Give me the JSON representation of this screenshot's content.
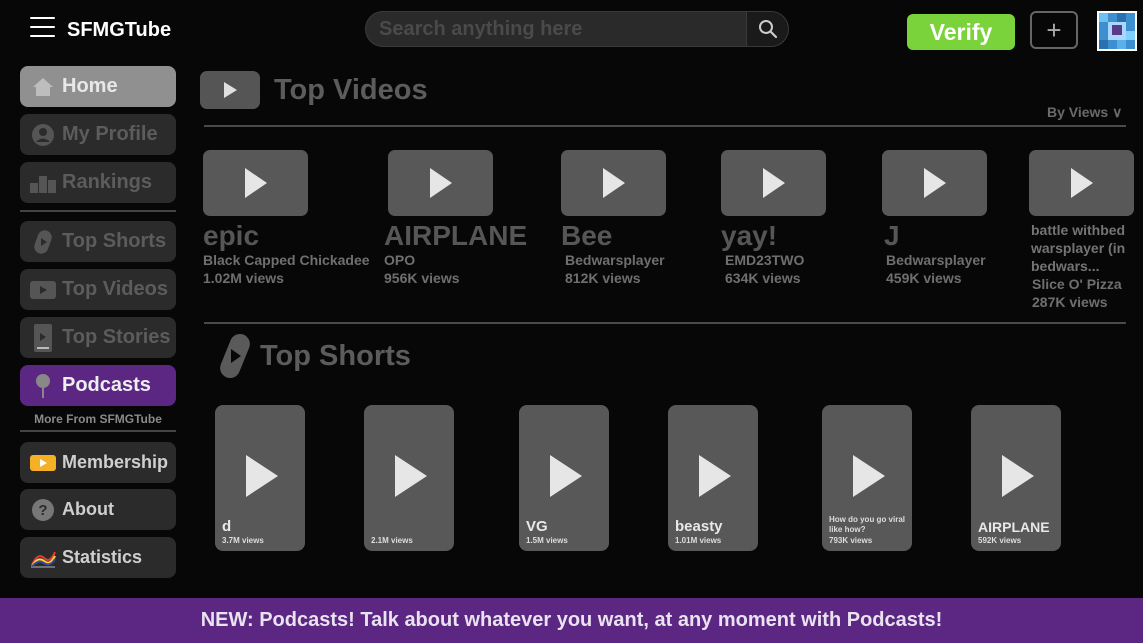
{
  "header": {
    "brand": "SFMGTube",
    "search_placeholder": "Search anything here",
    "verify_label": "Verify",
    "plus_label": "+"
  },
  "sidebar": {
    "items": [
      {
        "label": "Home",
        "icon": "home-icon"
      },
      {
        "label": "My Profile",
        "icon": "profile-icon"
      },
      {
        "label": "Rankings",
        "icon": "podium-icon"
      },
      {
        "label": "Top Shorts",
        "icon": "shorts-icon"
      },
      {
        "label": "Top Videos",
        "icon": "video-icon"
      },
      {
        "label": "Top Stories",
        "icon": "story-icon"
      },
      {
        "label": "Podcasts",
        "icon": "microphone-icon"
      }
    ],
    "more_from": "More From SFMGTube",
    "lower_items": [
      {
        "label": "Membership",
        "icon": "membership-icon"
      },
      {
        "label": "About",
        "icon": "question-icon"
      },
      {
        "label": "Statistics",
        "icon": "chart-icon"
      }
    ]
  },
  "top_videos": {
    "title": "Top Videos",
    "sort_label": "By Views ∨",
    "items": [
      {
        "title": "epic",
        "author": "Black Capped Chickadee",
        "views": "1.02M views"
      },
      {
        "title": "AIRPLANE",
        "author": "OPO",
        "views": "956K views"
      },
      {
        "title": "Bee",
        "author": "Bedwarsplayer",
        "views": "812K views"
      },
      {
        "title": "yay!",
        "author": "EMD23TWO",
        "views": "634K views"
      },
      {
        "title": "J",
        "author": "Bedwarsplayer",
        "views": "459K views"
      },
      {
        "title": "battle withbed warsplayer (in bedwars...",
        "author": "Slice O' Pizza",
        "views": "287K views"
      }
    ]
  },
  "top_shorts": {
    "title": "Top Shorts",
    "items": [
      {
        "title": "d",
        "views": "3.7M views"
      },
      {
        "title": "",
        "views": "2.1M views"
      },
      {
        "title": "VG",
        "views": "1.5M views"
      },
      {
        "title": "beasty",
        "views": "1.01M views"
      },
      {
        "title": "How do you go viral like how?",
        "views": "793K views"
      },
      {
        "title": "AIRPLANE",
        "views": "592K views"
      }
    ]
  },
  "banner": "NEW: Podcasts! Talk about whatever you want, at any moment with Podcasts!"
}
